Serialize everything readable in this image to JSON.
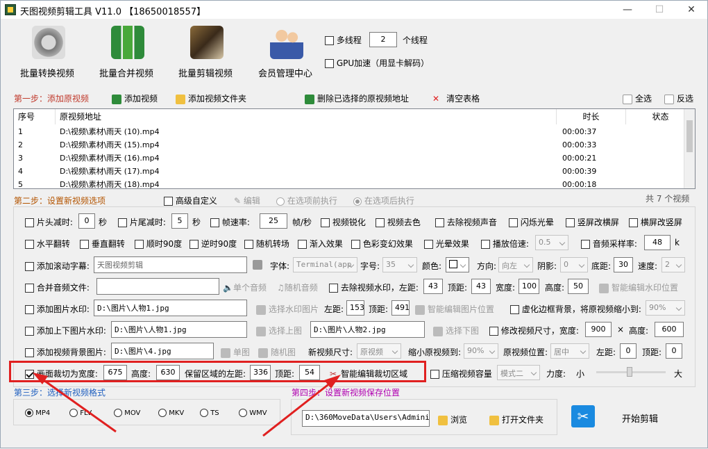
{
  "window": {
    "title": "天图视频剪辑工具 V11.0  【18650018557】",
    "minimize": "—",
    "maximize": "☐",
    "close": "✕"
  },
  "toolbar": {
    "batch_convert": "批量转换视频",
    "batch_merge": "批量合并视频",
    "batch_edit": "批量剪辑视频",
    "member_center": "会员管理中心"
  },
  "threads": {
    "multithread_label": "多线程",
    "thread_count": "2",
    "thread_unit": "个线程",
    "gpu_label": "GPU加速（用显卡解码）"
  },
  "step1": {
    "label": "第一步：添加原视频",
    "add_video": "添加视频",
    "add_folder": "添加视频文件夹",
    "delete_selected": "删除已选择的原视频地址",
    "clear_table": "清空表格",
    "select_all": "全选",
    "invert": "反选"
  },
  "table": {
    "headers": [
      "序号",
      "原视频地址",
      "时长",
      "状态"
    ],
    "rows": [
      {
        "no": "1",
        "path": "D:\\视频\\素材\\雨天 (10).mp4",
        "duration": "00:00:37",
        "status": ""
      },
      {
        "no": "2",
        "path": "D:\\视频\\素材\\雨天 (15).mp4",
        "duration": "00:00:33",
        "status": ""
      },
      {
        "no": "3",
        "path": "D:\\视频\\素材\\雨天 (16).mp4",
        "duration": "00:00:21",
        "status": ""
      },
      {
        "no": "4",
        "path": "D:\\视频\\素材\\雨天 (17).mp4",
        "duration": "00:00:39",
        "status": ""
      },
      {
        "no": "5",
        "path": "D:\\视频\\素材\\雨天 (18).mp4",
        "duration": "00:00:18",
        "status": ""
      }
    ],
    "total": "共 7 个视频"
  },
  "step2": {
    "label": "第二步：设置新视频选项",
    "advanced": "高级自定义",
    "edit": "编辑",
    "before": "在选项前执行",
    "after": "在选项后执行"
  },
  "row1": {
    "head_cut": "片头减时:",
    "head_val": "0",
    "sec1": "秒",
    "tail_cut": "片尾减时:",
    "tail_val": "5",
    "sec2": "秒",
    "fps": "帧速率:",
    "fps_val": "25",
    "fps_unit": "帧/秒",
    "sharpen": "视频锐化",
    "decolor": "视频去色",
    "remove_audio": "去除视频声音",
    "flash": "闪烁光晕",
    "v2h": "竖屏改横屏",
    "h2v": "横屏改竖屏"
  },
  "row2": {
    "hflip": "水平翻转",
    "vflip": "垂直翻转",
    "cw90": "顺时90度",
    "ccw90": "逆时90度",
    "random_trans": "随机转场",
    "fade_in": "渐入效果",
    "color_fx": "色彩变幻效果",
    "light_fx": "光晕效果",
    "speed": "播放倍速:",
    "speed_val": "0.5",
    "sample_rate": "音频采样率:",
    "sample_val": "48",
    "k": "k"
  },
  "row3": {
    "subtitle": "添加滚动字幕:",
    "subtitle_val": "天图视频剪辑",
    "font": "字体:",
    "font_val": "Terminal(app",
    "size": "字号:",
    "size_val": "35",
    "color": "颜色:",
    "dir": "方向:",
    "dir_val": "向左",
    "shadow": "阴影:",
    "shadow_val": "0",
    "bottom": "底距:",
    "bottom_val": "30",
    "speed": "速度:",
    "speed_val": "2"
  },
  "row4": {
    "merge_audio": "合并音频文件:",
    "single_audio": "单个音频",
    "random_audio": "随机音频",
    "remove_wm": "去除视频水印，左距:",
    "left_val": "43",
    "top": "顶距:",
    "top_val": "43",
    "width": "宽度:",
    "width_val": "100",
    "height": "高度:",
    "height_val": "50",
    "smart_wm": "智能编辑水印位置"
  },
  "row5": {
    "img_wm": "添加图片水印:",
    "img_path": "D:\\图片\\人物1.jpg",
    "choose_img": "选择水印图片",
    "left": "左距:",
    "left_val": "153",
    "top": "顶距:",
    "top_val": "491",
    "smart_img": "智能编辑图片位置",
    "blur_bg": "虚化边框背景，将原视频缩小到:",
    "blur_val": "90%"
  },
  "row6": {
    "tb_wm": "添加上下图片水印:",
    "top_path": "D:\\图片\\人物1.jpg",
    "choose_top": "选择上图",
    "bottom_path": "D:\\图片\\人物2.jpg",
    "choose_bottom": "选择下图",
    "resize": "修改视频尺寸，宽度:",
    "w_val": "900",
    "x": "×",
    "h_label": "高度:",
    "h_val": "600"
  },
  "row7": {
    "bg_img": "添加视频背景图片:",
    "bg_path": "D:\\图片\\4.jpg",
    "single": "单图",
    "random": "随机图",
    "new_size": "新视频尺寸:",
    "new_size_val": "原视频",
    "shrink": "缩小原视频到:",
    "shrink_val": "90%",
    "pos": "原视频位置:",
    "pos_val": "居中",
    "left": "左距:",
    "left_val": "0",
    "top": "顶距:",
    "top_val": "0"
  },
  "row8": {
    "crop": "画面裁切为宽度:",
    "crop_w": "675",
    "h": "高度:",
    "crop_h": "630",
    "keep_left": "保留区域的左距:",
    "left_val": "336",
    "top": "顶距:",
    "top_val": "54",
    "smart_crop": "智能编辑裁切区域",
    "compress": "压缩视频容量",
    "mode_val": "模式二",
    "strength": "力度:",
    "small": "小",
    "large": "大"
  },
  "step3": {
    "label": "第三步：选择新视频格式",
    "formats": [
      "MP4",
      "FLV",
      "MOV",
      "MKV",
      "TS",
      "WMV"
    ]
  },
  "step4": {
    "label": "第四步：设置新视频保存位置",
    "path": "D:\\360MoveData\\Users\\Administr",
    "browse": "浏览",
    "open_folder": "打开文件夹",
    "start": "开始剪辑"
  },
  "colors": {
    "highlight": "#e02020",
    "step1": "#c0392b",
    "step3": "#1f5fbf",
    "step4": "#b000b0"
  }
}
